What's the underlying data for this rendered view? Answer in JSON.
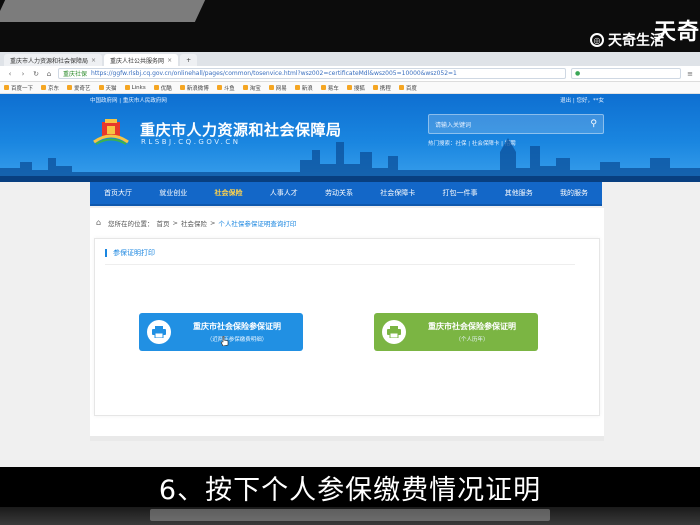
{
  "watermark": {
    "brand": "天奇生活",
    "corner": "天奇"
  },
  "browser": {
    "tabs": [
      {
        "label": "重庆市人力资源和社会保障局"
      },
      {
        "label": "重庆人社公共服务网"
      }
    ],
    "new_tab": "+",
    "address": {
      "secure_label": "重庆社保",
      "url": "https://ggfw.rlsbj.cq.gov.cn/onlinehall/pages/common/tosenvice.html?wsz002=certificateMdl&wsz005=10000&wsz052=1"
    },
    "bookmarks": [
      "百度一下",
      "京东",
      "爱奇艺",
      "天猫",
      "Links",
      "优酷",
      "新浪微博",
      "斗鱼",
      "淘宝",
      "网易",
      "新浪",
      "易车",
      "搜狐",
      "携程",
      "百度"
    ]
  },
  "site": {
    "top_links": "中国政府网 | 重庆市人民政府网",
    "top_right": "退出 | 您好，**女",
    "title": "重庆市人力资源和社会保障局",
    "subtitle": "RLSBJ.CQ.GOV.CN",
    "search_placeholder": "请输入关键词",
    "hot_searches": "热门搜索：社保 | 社会保障卡 | 招聘",
    "nav": [
      "首页大厅",
      "就业创业",
      "社会保险",
      "人事人才",
      "劳动关系",
      "社会保障卡",
      "打包一件事",
      "其他服务",
      "我的服务"
    ],
    "nav_active": 2
  },
  "breadcrumb": {
    "prefix": "您所在的位置：",
    "items": [
      "首页",
      "社会保险"
    ],
    "current": "个人社保参保证明查询打印"
  },
  "section_title": "参保证明打印",
  "buttons": [
    {
      "label": "重庆市社会保险参保证明",
      "sub": "（近两年参保缴费明细）"
    },
    {
      "label": "重庆市社会保险参保证明",
      "sub": "（个人历年）"
    }
  ],
  "caption": "6、按下个人参保缴费情况证明",
  "colors": {
    "nav": "#1367c8",
    "blue_button": "#2190e3",
    "green_button": "#7bb543",
    "accent": "#1a86e0"
  }
}
